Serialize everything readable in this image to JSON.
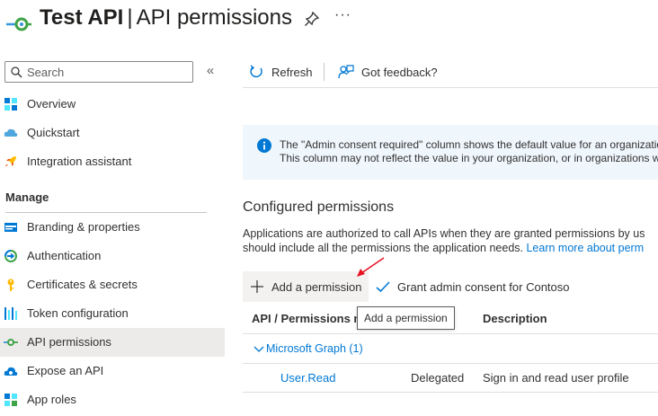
{
  "header": {
    "app_name": "Test API",
    "separator": "|",
    "page_name": "API permissions",
    "more_label": "···"
  },
  "sidebar": {
    "search": {
      "placeholder": "Search"
    },
    "collapse_label": "«",
    "items_top": [
      {
        "label": "Overview",
        "icon": "overview-icon"
      },
      {
        "label": "Quickstart",
        "icon": "quickstart-icon"
      },
      {
        "label": "Integration assistant",
        "icon": "rocket-icon"
      }
    ],
    "section": "Manage",
    "items_manage": [
      {
        "label": "Branding & properties",
        "icon": "branding-icon"
      },
      {
        "label": "Authentication",
        "icon": "authentication-icon"
      },
      {
        "label": "Certificates & secrets",
        "icon": "key-icon"
      },
      {
        "label": "Token configuration",
        "icon": "token-icon"
      },
      {
        "label": "API permissions",
        "icon": "api-permissions-icon",
        "active": true
      },
      {
        "label": "Expose an API",
        "icon": "cloud-icon"
      },
      {
        "label": "App roles",
        "icon": "app-roles-icon"
      }
    ]
  },
  "toolbar": {
    "refresh_label": "Refresh",
    "feedback_label": "Got feedback?"
  },
  "banner": {
    "line1": "The \"Admin consent required\" column shows the default value for an organization",
    "line2": "This column may not reflect the value in your organization, or in organizations w"
  },
  "configured": {
    "heading": "Configured permissions",
    "desc_line1": "Applications are authorized to call APIs when they are granted permissions by us",
    "desc_line2": "should include all the permissions the application needs.",
    "learn_more": "Learn more about perm",
    "add_permission_label": "Add a permission",
    "grant_consent_label": "Grant admin consent for Contoso",
    "tooltip": "Add a permission"
  },
  "table": {
    "col_name": "API / Permissions na",
    "col_description": "Description",
    "group": "Microsoft Graph (1)",
    "rows": [
      {
        "name": "User.Read",
        "type": "Delegated",
        "description": "Sign in and read user profile"
      }
    ]
  },
  "colors": {
    "accent": "#0078d4",
    "active_nav": "#edebe9",
    "banner_bg": "#eff6fc",
    "arrow": "#e81123"
  }
}
